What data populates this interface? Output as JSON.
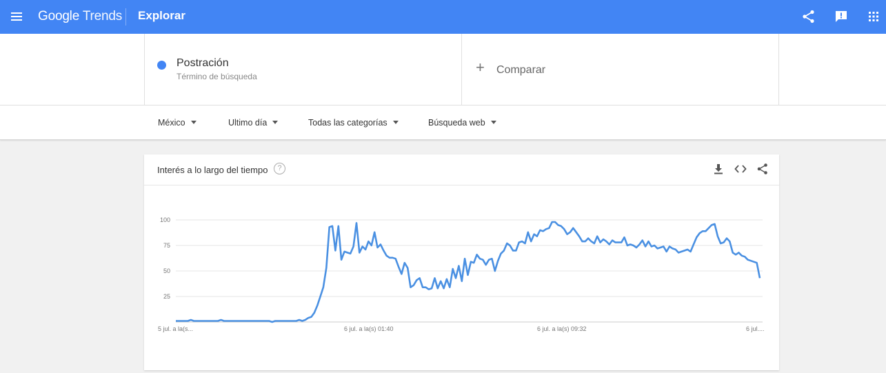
{
  "header": {
    "logo_google": "Google",
    "logo_trends": "Trends",
    "page_title": "Explorar"
  },
  "term": {
    "name": "Postración",
    "subtitle": "Término de búsqueda",
    "color": "#4285f4"
  },
  "compare": {
    "plus": "+",
    "label": "Comparar"
  },
  "filters": {
    "region": "México",
    "time": "Ultimo día",
    "category": "Todas las categorías",
    "search_type": "Búsqueda web"
  },
  "card": {
    "title": "Interés a lo largo del tiempo",
    "help": "?"
  },
  "colors": {
    "brand": "#4285f4",
    "line": "#4a90e2"
  },
  "icons": [
    "menu-icon",
    "share-icon",
    "feedback-icon",
    "apps-icon",
    "download-icon",
    "embed-icon",
    "help-icon"
  ],
  "chart_data": {
    "type": "line",
    "ylim": [
      0,
      100
    ],
    "yticks": [
      25,
      50,
      75,
      100
    ],
    "xticks": [
      "5 jul. a la(s...",
      "6 jul. a la(s) 01:40",
      "6 jul. a la(s) 09:32",
      "6 jul...."
    ],
    "series": [
      {
        "values": [
          1,
          1,
          1,
          1,
          1,
          2,
          1,
          1,
          1,
          1,
          1,
          1,
          1,
          1,
          1,
          2,
          1,
          1,
          1,
          1,
          1,
          1,
          1,
          1,
          1,
          1,
          1,
          1,
          1,
          1,
          1,
          1,
          0,
          1,
          1,
          1,
          1,
          1,
          1,
          1,
          1,
          2,
          1,
          2,
          4,
          5,
          9,
          16,
          25,
          34,
          53,
          93,
          94,
          70,
          94,
          61,
          69,
          68,
          67,
          74,
          97,
          68,
          74,
          71,
          79,
          75,
          88,
          73,
          76,
          70,
          65,
          63,
          63,
          62,
          54,
          47,
          58,
          53,
          34,
          36,
          41,
          43,
          34,
          34,
          32,
          33,
          43,
          33,
          40,
          33,
          42,
          34,
          52,
          43,
          55,
          40,
          62,
          46,
          59,
          58,
          66,
          62,
          61,
          56,
          61,
          62,
          50,
          60,
          67,
          70,
          77,
          75,
          70,
          70,
          78,
          79,
          77,
          88,
          79,
          86,
          84,
          90,
          89,
          91,
          92,
          98,
          98,
          95,
          94,
          91,
          86,
          88,
          92,
          88,
          84,
          79,
          79,
          82,
          79,
          77,
          84,
          78,
          81,
          79,
          76,
          80,
          78,
          78,
          78,
          83,
          75,
          76,
          75,
          73,
          76,
          80,
          74,
          79,
          74,
          75,
          72,
          73,
          74,
          69,
          74,
          72,
          71,
          68,
          69,
          70,
          71,
          69,
          76,
          83,
          87,
          89,
          89,
          92,
          95,
          96,
          84,
          77,
          78,
          82,
          79,
          68,
          66,
          68,
          65,
          64,
          61,
          60,
          59,
          58,
          43
        ]
      }
    ]
  }
}
